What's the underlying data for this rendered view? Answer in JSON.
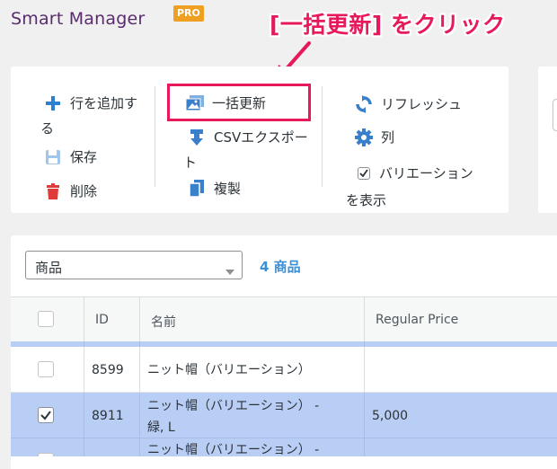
{
  "app": {
    "title": "Smart Manager",
    "badge": "PRO"
  },
  "annotation": {
    "callout": "[一括更新] をクリック",
    "color": "#e6195a"
  },
  "toolbar": {
    "add_row_line1": "行を追加す",
    "add_row_line2": "る",
    "save": "保存",
    "delete": "削除",
    "bulk_edit": "一括更新",
    "csv_export_line1": "CSVエクスポー",
    "csv_export_line2": "ト",
    "duplicate": "複製",
    "refresh": "リフレッシュ",
    "columns": "列",
    "show_variations_line1": "バリエーション",
    "show_variations_line2": "を表示",
    "show_variations_checked": true
  },
  "filter": {
    "selected": "商品",
    "count_label": "4 商品"
  },
  "table": {
    "columns": [
      "ID",
      "名前",
      "Regular Price"
    ],
    "rows": [
      {
        "id": "8599",
        "name_line1": "ニット帽（バリエーション）",
        "name_line2": "",
        "price": "",
        "checked": false
      },
      {
        "id": "8911",
        "name_line1": "ニット帽（バリエーション） -",
        "name_line2": "緑, L",
        "price": "5,000",
        "checked": true
      },
      {
        "id": "",
        "name_line1": "ニット帽（バリエーション） -",
        "name_line2": "",
        "price": "",
        "checked": true
      }
    ]
  },
  "colors": {
    "accent": "#3a8fd6",
    "title": "#5a2a6e",
    "badge": "#f0a020",
    "selected_row": "#b9cef5"
  }
}
